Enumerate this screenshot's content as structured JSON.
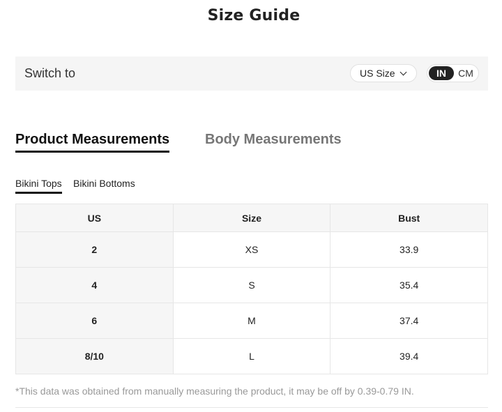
{
  "title": "Size Guide",
  "switch": {
    "label": "Switch to",
    "size_select": "US Size",
    "units": {
      "in": "IN",
      "cm": "CM",
      "selected": "IN"
    }
  },
  "tabs": {
    "product": "Product Measurements",
    "body": "Body Measurements",
    "active": "product"
  },
  "subtabs": {
    "tops": "Bikini Tops",
    "bottoms": "Bikini Bottoms",
    "active": "tops"
  },
  "table": {
    "headers": [
      "US",
      "Size",
      "Bust"
    ],
    "rows": [
      [
        "2",
        "XS",
        "33.9"
      ],
      [
        "4",
        "S",
        "35.4"
      ],
      [
        "6",
        "M",
        "37.4"
      ],
      [
        "8/10",
        "L",
        "39.4"
      ]
    ]
  },
  "note": "*This data was obtained from manually measuring the product, it may be off by 0.39-0.79 IN."
}
